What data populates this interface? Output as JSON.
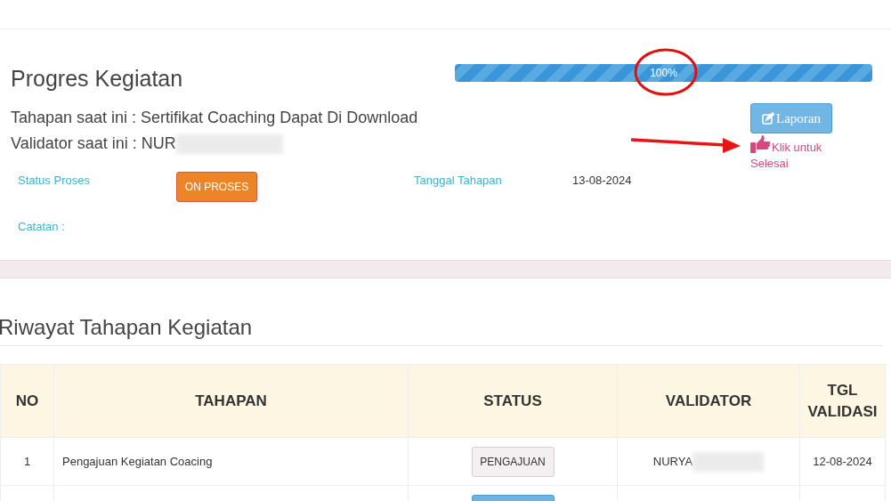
{
  "header": {
    "title": "Progres Kegiatan"
  },
  "progress": {
    "level": 1,
    "label": "100%"
  },
  "current_stage": "Tahapan saat ini : Sertifikat Coaching Dapat Di Download",
  "current_validator": "Validator saat ini : NUR",
  "report_button": "Laporan",
  "finish_link": "Klik untuk Selesai",
  "status": {
    "label": "Status Proses",
    "value": "ON PROSES"
  },
  "stage_date": {
    "label": "Tanggal Tahapan",
    "value": "13-08-2024"
  },
  "notes": {
    "label": "Catatan :"
  },
  "history": {
    "title": "Riwayat Tahapan Kegiatan",
    "columns": [
      "NO",
      "TAHAPAN",
      "STATUS",
      "VALIDATOR",
      "TGL VALIDASI"
    ],
    "rows": [
      {
        "no": "1",
        "stage": "Pengajuan Kegiatan Coacing",
        "status": "PENGAJUAN",
        "kind": "submitted",
        "validator": "NURYA",
        "date": "12-08-2024"
      },
      {
        "kind": "info"
      }
    ]
  }
}
